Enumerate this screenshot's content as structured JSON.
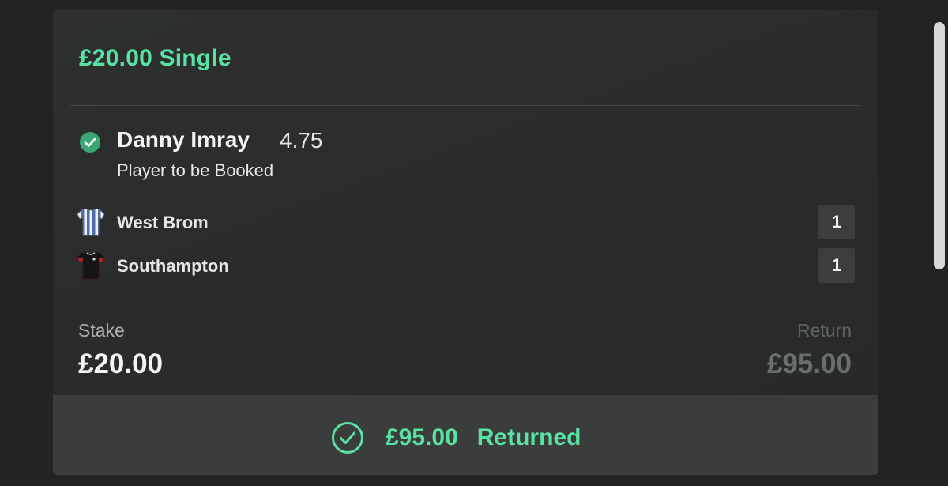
{
  "bet": {
    "title": "£20.00 Single",
    "selection": {
      "name": "Danny Imray",
      "odds": "4.75",
      "market": "Player to be Booked",
      "status_icon": "check-circle-icon"
    },
    "teams": [
      {
        "name": "West Brom",
        "score": "1",
        "kit_icon": "striped-shirt-icon"
      },
      {
        "name": "Southampton",
        "score": "1",
        "kit_icon": "dark-shirt-icon"
      }
    ],
    "stake": {
      "label": "Stake",
      "value": "£20.00"
    },
    "return": {
      "label": "Return",
      "value": "£95.00"
    },
    "result": {
      "amount": "£95.00",
      "status": "Returned",
      "icon": "check-circle-outline-icon"
    }
  },
  "colors": {
    "accent": "#58e3a2",
    "background": "#232323",
    "card": "#2b2d2d",
    "footer": "#3b3d3d"
  }
}
